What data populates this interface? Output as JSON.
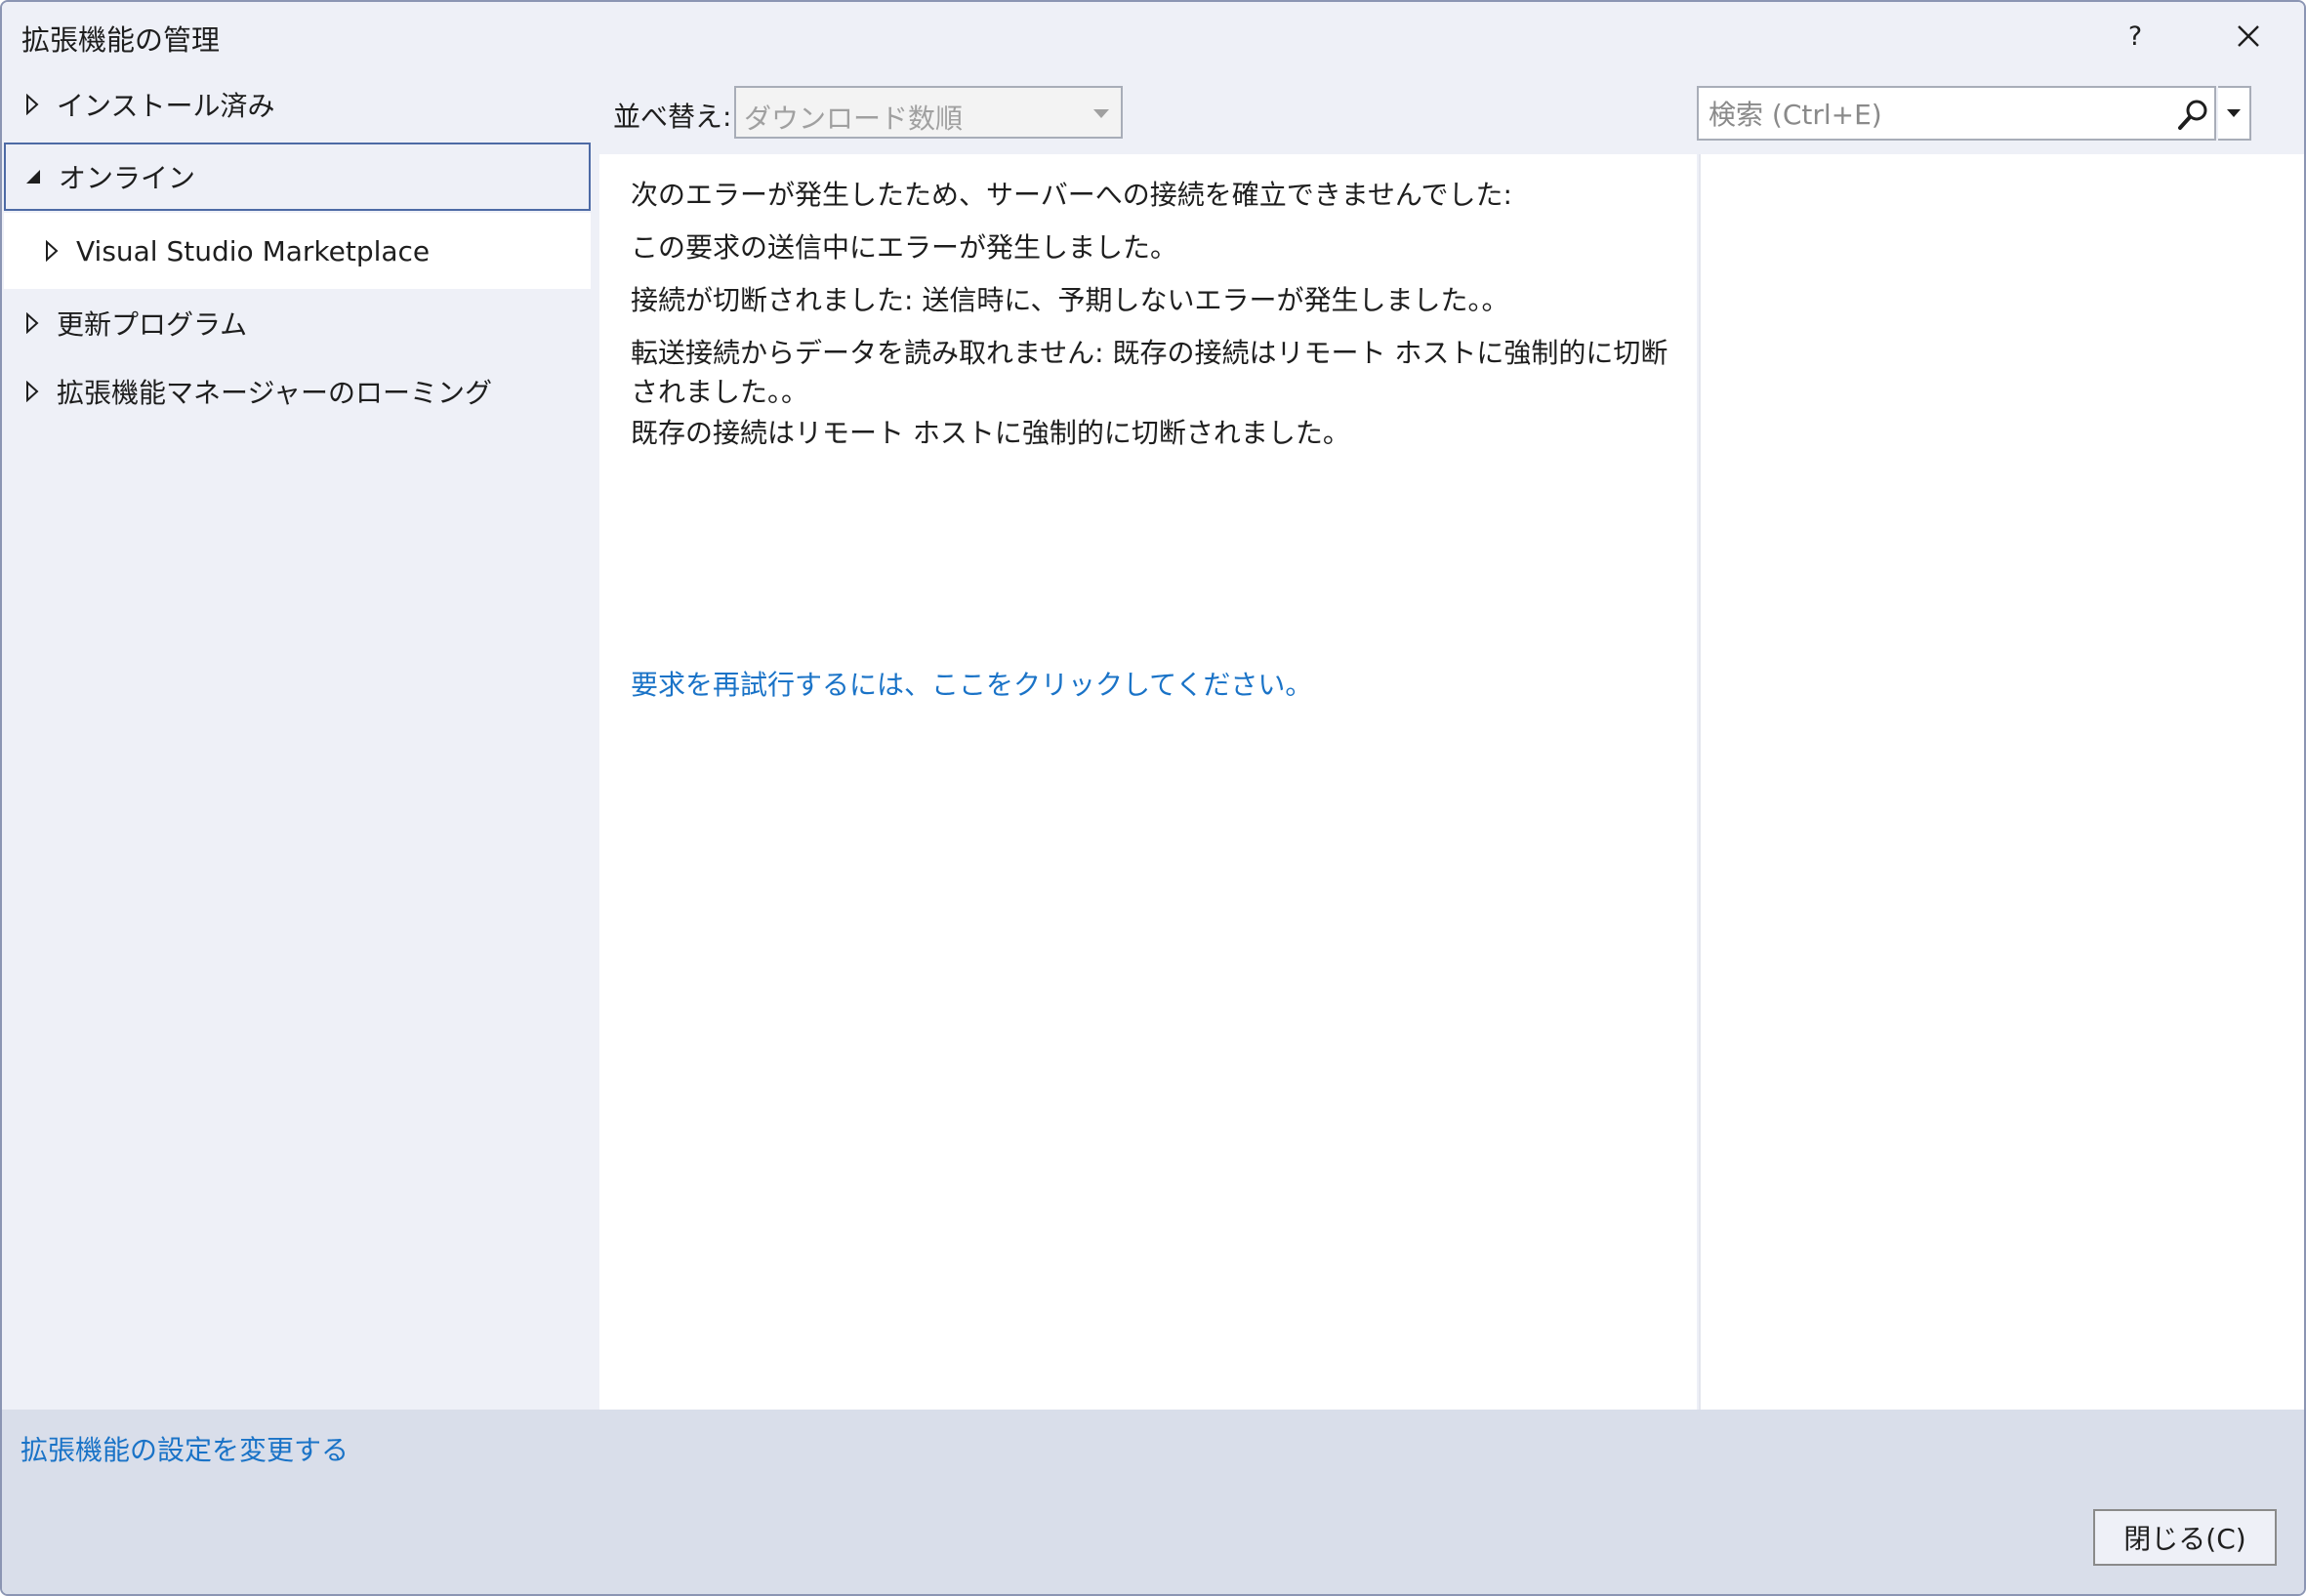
{
  "window": {
    "title": "拡張機能の管理",
    "help_label": "?"
  },
  "sidebar": {
    "items": [
      {
        "label": "インストール済み",
        "state": "collapsed"
      },
      {
        "label": "オンライン",
        "state": "expanded",
        "selected": true
      },
      {
        "label": "Visual Studio Marketplace",
        "state": "collapsed"
      },
      {
        "label": "更新プログラム",
        "state": "collapsed"
      },
      {
        "label": "拡張機能マネージャーのローミング",
        "state": "collapsed"
      }
    ]
  },
  "toolbar": {
    "sort_label": "並べ替え:",
    "sort_value": "ダウンロード数順",
    "search_placeholder": "検索 (Ctrl+E)"
  },
  "content": {
    "messages": [
      "次のエラーが発生したため、サーバーへの接続を確立できませんでした:",
      "この要求の送信中にエラーが発生しました。",
      "接続が切断されました: 送信時に、予期しないエラーが発生しました。。",
      "転送接続からデータを読み取れません: 既存の接続はリモート ホストに強制的に切断されました。。",
      "既存の接続はリモート ホストに強制的に切断されました。"
    ],
    "retry_link": "要求を再試行するには、ここをクリックしてください。"
  },
  "footer": {
    "settings_link": "拡張機能の設定を変更する",
    "close_button": "閉じる(C)"
  },
  "colors": {
    "link": "#1a73c7",
    "selection_border": "#4d6aa5",
    "chrome_background": "#eef0f7",
    "footer_background": "#d9deea"
  }
}
